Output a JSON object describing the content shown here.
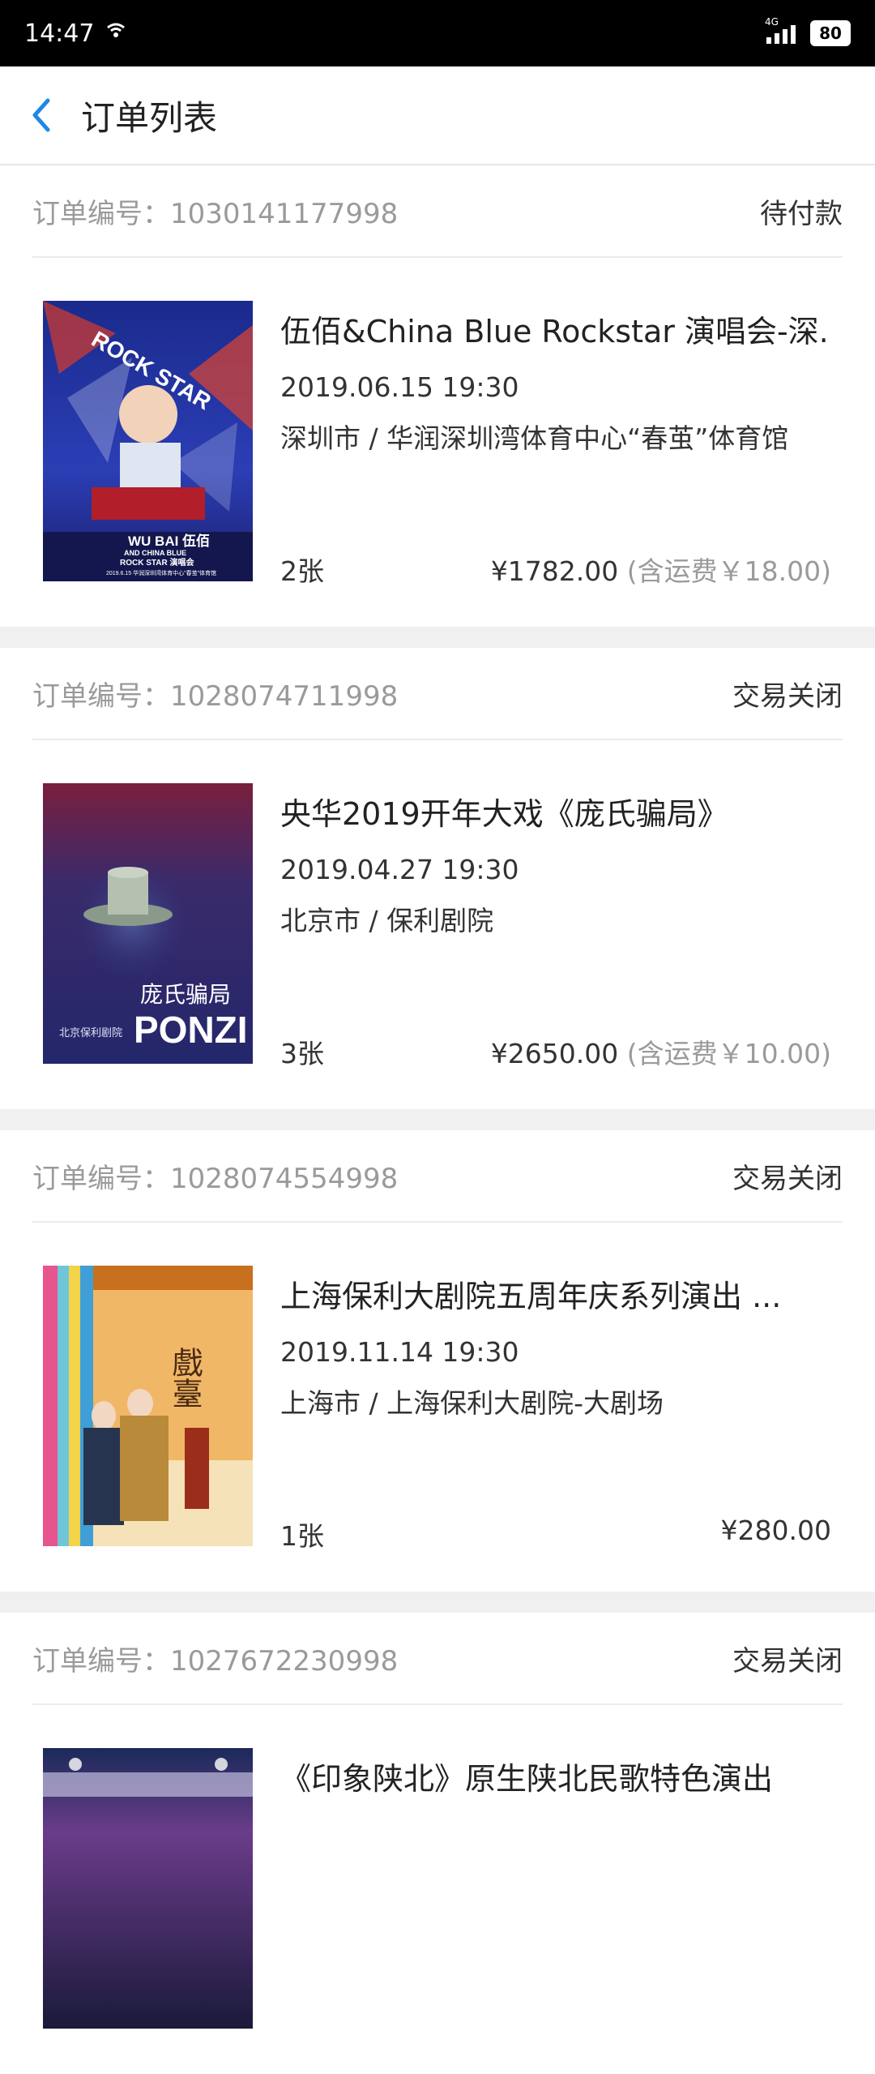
{
  "status_bar": {
    "time": "14:47",
    "network": "4G",
    "battery": "80"
  },
  "header": {
    "title": "订单列表"
  },
  "orders": [
    {
      "order_label": "订单编号：",
      "order_number": "1030141177998",
      "status": "待付款",
      "title": "伍佰&China Blue Rockstar 演唱会-深..",
      "datetime": "2019.06.15 19:30",
      "venue": "深圳市 / 华润深圳湾体育中心“春茧”体育馆",
      "quantity": "2张",
      "price": "¥1782.00",
      "shipping": " (含运费￥18.00)",
      "poster": {
        "top_text": "ROCK STAR",
        "main_text": "WU BAI 伍佰",
        "sub_text": "AND CHINA BLUE",
        "sub_text2": "ROCK STAR 演唱会",
        "date_line": "2019.6.15 华润深圳湾体育中心\"春茧\"体育馆"
      }
    },
    {
      "order_label": "订单编号：",
      "order_number": "1028074711998",
      "status": "交易关闭",
      "title": "央华2019开年大戏《庞氏骗局》",
      "datetime": "2019.04.27 19:30",
      "venue": "北京市 / 保利剧院",
      "quantity": "3张",
      "price": "¥2650.00",
      "shipping": " (含运费￥10.00)",
      "poster": {
        "cn_title": "庞氏骗局",
        "en_title": "PONZI",
        "place": "北京保利剧院"
      }
    },
    {
      "order_label": "订单编号：",
      "order_number": "1028074554998",
      "status": "交易关闭",
      "title": "上海保利大剧院五周年庆系列演出 ...",
      "datetime": "2019.11.14 19:30",
      "venue": "上海市 / 上海保利大剧院-大剧场",
      "quantity": "1张",
      "price": "¥280.00",
      "shipping": "",
      "poster": {
        "main_text": "戲臺"
      }
    },
    {
      "order_label": "订单编号：",
      "order_number": "1027672230998",
      "status": "交易关闭",
      "title": "《印象陕北》原生陕北民歌特色演出",
      "datetime": "",
      "venue": "",
      "quantity": "",
      "price": "",
      "shipping": ""
    }
  ],
  "colors": {
    "accent": "#1e88e5",
    "muted": "#9a9a9a",
    "divider": "#f0f0f0"
  }
}
